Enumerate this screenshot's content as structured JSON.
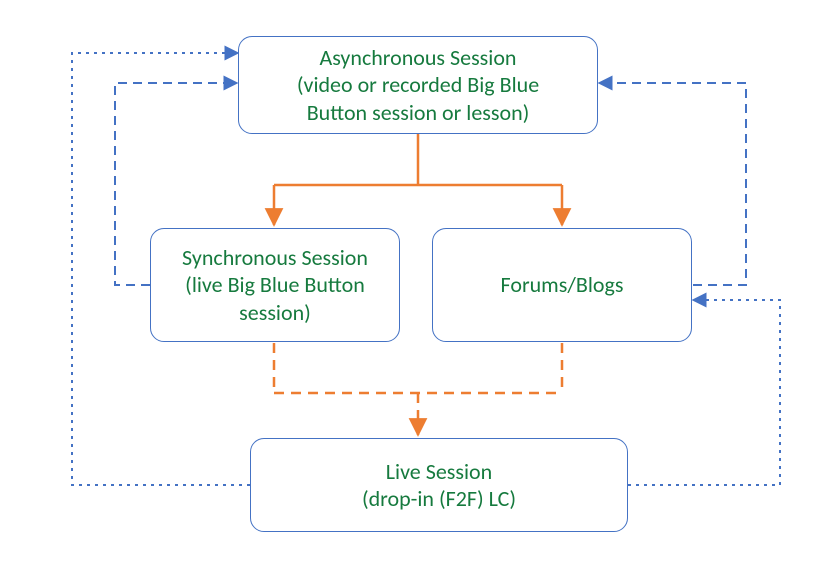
{
  "colors": {
    "node_border": "#4472C4",
    "node_text": "#167A3E",
    "arrow_orange": "#ED7D31",
    "arrow_blue": "#4472C4"
  },
  "nodes": {
    "async": {
      "line1": "Asynchronous Session",
      "line2": "(video or recorded Big Blue",
      "line3": "Button session or lesson)"
    },
    "sync": {
      "line1": "Synchronous Session",
      "line2": "(live Big Blue Button",
      "line3": "session)"
    },
    "forums": {
      "line1": "Forums/Blogs"
    },
    "live": {
      "line1": "Live Session",
      "line2": "(drop-in (F2F) LC)"
    }
  },
  "edges": [
    {
      "from": "async",
      "to": "sync",
      "style": "solid",
      "color": "orange"
    },
    {
      "from": "async",
      "to": "forums",
      "style": "solid",
      "color": "orange"
    },
    {
      "from": "sync",
      "to": "live",
      "style": "dashed",
      "color": "orange"
    },
    {
      "from": "forums",
      "to": "live",
      "style": "dashed",
      "color": "orange"
    },
    {
      "from": "sync",
      "to": "async",
      "style": "dashed",
      "color": "blue",
      "route": "left-outer"
    },
    {
      "from": "forums",
      "to": "async",
      "style": "dashed",
      "color": "blue",
      "route": "right-upper"
    },
    {
      "from": "live",
      "to": "async",
      "style": "dotted",
      "color": "blue",
      "route": "left-outer-wide"
    },
    {
      "from": "live",
      "to": "forums",
      "style": "dotted",
      "color": "blue",
      "route": "right-lower"
    }
  ]
}
